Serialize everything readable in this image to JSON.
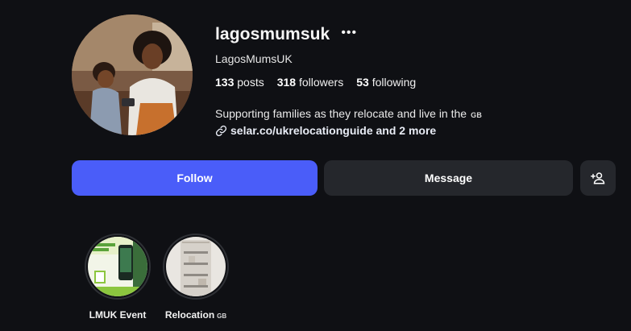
{
  "profile": {
    "username": "lagosmumsuk",
    "more_icon": "more-horizontal-icon",
    "full_name": "LagosMumsUK",
    "stats": {
      "posts_count": "133",
      "posts_label": "posts",
      "followers_count": "318",
      "followers_label": "followers",
      "following_count": "53",
      "following_label": "following"
    },
    "bio_text": "Supporting families as they relocate and live in the",
    "bio_flag": "GB",
    "link_icon": "link-icon",
    "link_text": "selar.co/ukrelocationguide and 2 more"
  },
  "actions": {
    "follow_label": "Follow",
    "message_label": "Message",
    "suggest_icon": "add-person-icon"
  },
  "highlights": [
    {
      "label": "LMUK Event",
      "flag": ""
    },
    {
      "label": "Relocation",
      "flag": "GB"
    }
  ],
  "colors": {
    "background": "#0f1014",
    "follow_button": "#4a5df9",
    "secondary_button": "#25272c"
  }
}
